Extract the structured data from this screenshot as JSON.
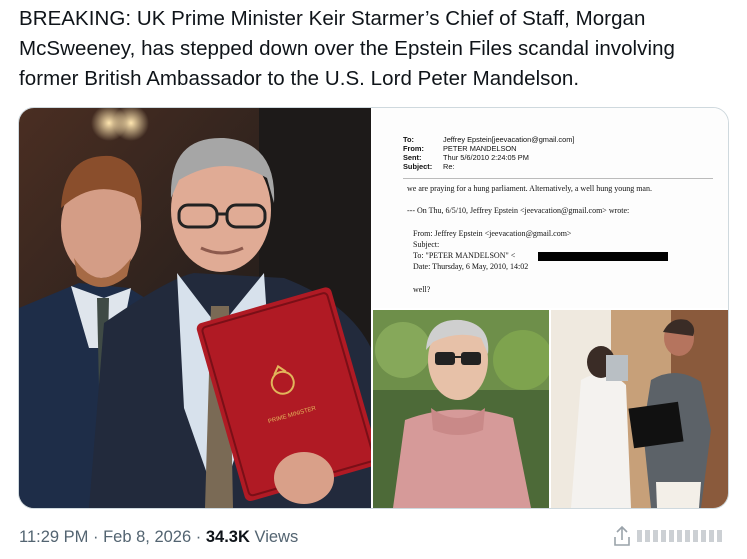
{
  "tweet": {
    "text": "BREAKING: UK Prime Minister Keir Starmer’s Chief of Staff, Morgan McSweeney, has stepped down over the Epstein Files scandal involving former British Ambassador to the U.S. Lord Peter Mandelson.",
    "time": "11:29 PM",
    "date": "Feb 8, 2026",
    "separator": "·",
    "views_count": "34.3K",
    "views_label": "Views"
  },
  "email_doc": {
    "to_label": "To:",
    "to_value": "Jeffrey Epstein[jeevacation@gmail.com]",
    "from_label": "From:",
    "from_value": "PETER MANDELSON",
    "sent_label": "Sent:",
    "sent_value": "Thur 5/6/2010 2:24:05 PM",
    "subject_label": "Subject:",
    "subject_value": "Re:",
    "line1": "we are praying for a hung parliament. Alternatively, a well hung young man.",
    "line2": "--- On Thu, 6/5/10, Jeffrey Epstein <jeevacation@gmail.com> wrote:",
    "line3": "From: Jeffrey Epstein <jeevacation@gmail.com>",
    "line4": "Subject:",
    "line5": "To: \"PETER MANDELSON\" <",
    "line6": "Date: Thursday, 6 May, 2010, 14:02",
    "line7": "well?"
  },
  "folder": {
    "text": "PRIME MINISTER"
  },
  "colors": {
    "meta": "#536471",
    "text": "#0f1419",
    "border": "#cfd9de",
    "folder_red": "#b01a24"
  },
  "icons": [
    "share-icon",
    "more-icon"
  ]
}
